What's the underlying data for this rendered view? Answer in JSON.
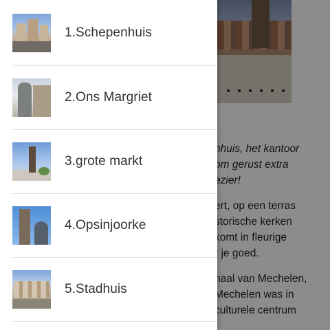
{
  "menu": {
    "items": [
      {
        "label": "1.Schepenhuis"
      },
      {
        "label": "2.Ons Margriet"
      },
      {
        "label": "3.grote markt"
      },
      {
        "label": "4.Opsinjoorke"
      },
      {
        "label": "5.Stadhuis"
      }
    ]
  },
  "background": {
    "text_italic": "nhuis, het kantoor\nom gerust extra\nezier!",
    "text_para1": "ert, op een terras\nstorische kerken\nkomt in fleurige\nr je goed.",
    "text_para2": "haal van Mechelen,\nMechelen was in\nculturele centrum"
  },
  "colors": {
    "scrim": "#000000",
    "drawer_bg": "#ffffff",
    "label_text": "#333333"
  }
}
